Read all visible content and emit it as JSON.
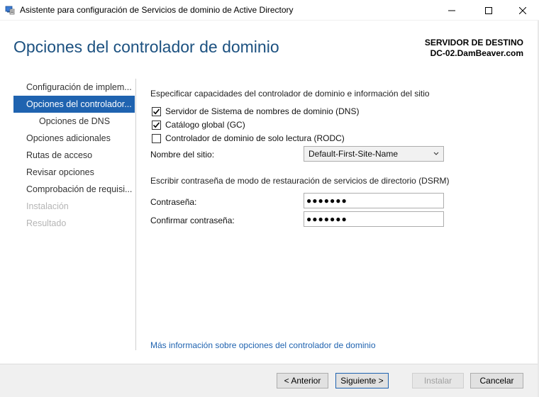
{
  "window": {
    "title": "Asistente para configuración de Servicios de dominio de Active Directory"
  },
  "header": {
    "title": "Opciones del controlador de dominio",
    "server_heading": "SERVIDOR DE DESTINO",
    "server_name": "DC-02.DamBeaver.com"
  },
  "nav": {
    "items": [
      {
        "label": "Configuración de implem...",
        "state": "normal"
      },
      {
        "label": "Opciones del controlador...",
        "state": "active"
      },
      {
        "label": "Opciones de DNS",
        "state": "sub"
      },
      {
        "label": "Opciones adicionales",
        "state": "normal"
      },
      {
        "label": "Rutas de acceso",
        "state": "normal"
      },
      {
        "label": "Revisar opciones",
        "state": "normal"
      },
      {
        "label": "Comprobación de requisi...",
        "state": "normal"
      },
      {
        "label": "Instalación",
        "state": "disabled"
      },
      {
        "label": "Resultado",
        "state": "disabled"
      }
    ]
  },
  "main": {
    "capabilities_heading": "Especificar capacidades del controlador de dominio e información del sitio",
    "capabilities": [
      {
        "label": "Servidor de Sistema de nombres de dominio (DNS)",
        "checked": true
      },
      {
        "label": "Catálogo global (GC)",
        "checked": true
      },
      {
        "label": "Controlador de dominio de solo lectura (RODC)",
        "checked": false
      }
    ],
    "site_label": "Nombre del sitio:",
    "site_value": "Default-First-Site-Name",
    "dsrm_heading": "Escribir contraseña de modo de restauración de servicios de directorio (DSRM)",
    "password_label": "Contraseña:",
    "password_value": "●●●●●●●",
    "confirm_label": "Confirmar contraseña:",
    "confirm_value": "●●●●●●●",
    "more_info_link": "Más información sobre opciones del controlador de dominio"
  },
  "footer": {
    "previous": "< Anterior",
    "next": "Siguiente >",
    "install": "Instalar",
    "cancel": "Cancelar"
  },
  "colors": {
    "title_blue": "#1c5180",
    "accent": "#1f63b0"
  }
}
